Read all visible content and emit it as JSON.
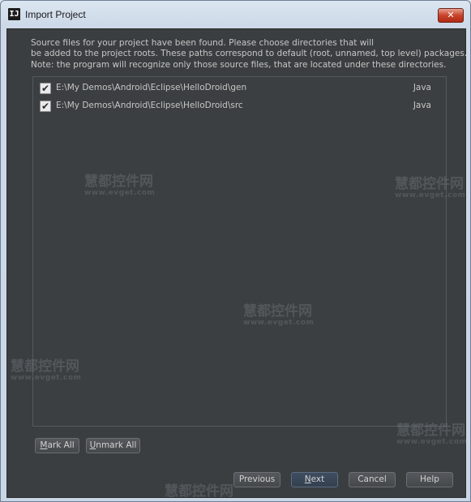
{
  "window": {
    "title": "Import Project",
    "app_icon_glyph": "IJ",
    "close_glyph": "✕"
  },
  "description": {
    "line1": "Source files for your project have been found. Please choose directories that will",
    "line2": "be added to the project roots. These paths correspond to default (root, unnamed, top level) packages.",
    "line3": "Note: the program will recognize only those source files, that are located under these directories."
  },
  "roots": [
    {
      "checked": true,
      "path": "E:\\My Demos\\Android\\Eclipse\\HelloDroid\\gen",
      "language": "Java"
    },
    {
      "checked": true,
      "path": "E:\\My Demos\\Android\\Eclipse\\HelloDroid\\src",
      "language": "Java"
    }
  ],
  "selection_buttons": {
    "mark_all": {
      "mnemonic": "M",
      "rest": "ark All"
    },
    "unmark_all": {
      "mnemonic": "U",
      "rest": "nmark All"
    }
  },
  "nav_buttons": {
    "previous": {
      "mnemonic": "",
      "rest": "Previous"
    },
    "next": {
      "mnemonic": "N",
      "rest": "ext"
    },
    "cancel": {
      "mnemonic": "",
      "rest": "Cancel"
    },
    "help": {
      "mnemonic": "",
      "rest": "Help"
    }
  },
  "watermark": {
    "text": "慧都控件网",
    "url": "www.evget.com"
  },
  "colors": {
    "dialog_bg": "#3b3e40",
    "text": "#c6c6c6",
    "default_button": "#3f4d60"
  }
}
